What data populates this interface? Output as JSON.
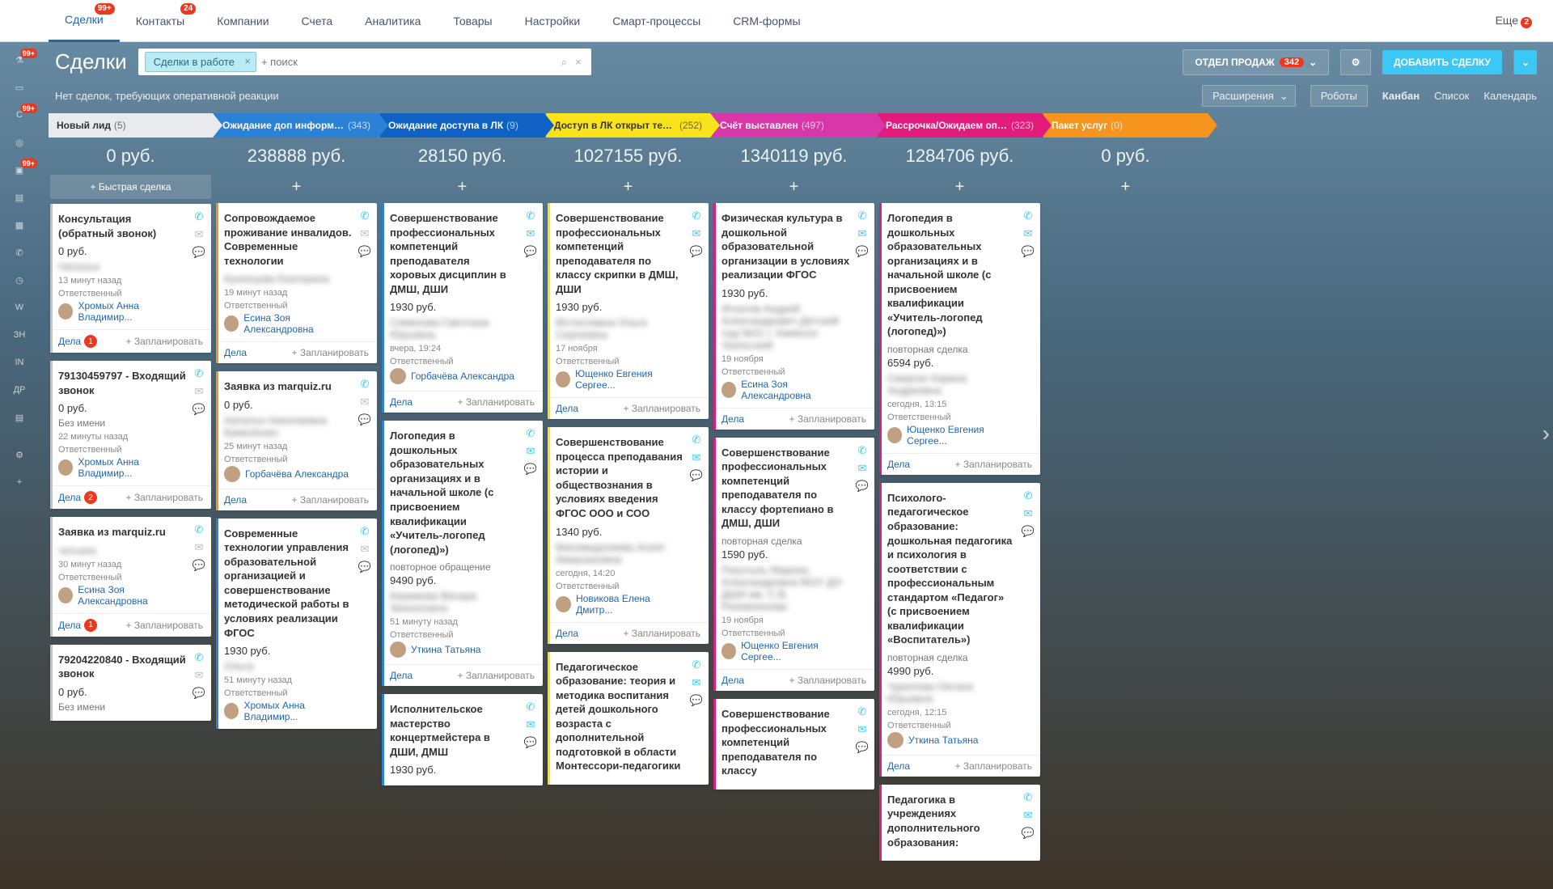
{
  "nav": {
    "items": [
      {
        "label": "Сделки",
        "badge": "99+",
        "active": true
      },
      {
        "label": "Контакты",
        "badge": "24"
      },
      {
        "label": "Компании"
      },
      {
        "label": "Счета"
      },
      {
        "label": "Аналитика"
      },
      {
        "label": "Товары"
      },
      {
        "label": "Настройки"
      },
      {
        "label": "Смарт-процессы"
      },
      {
        "label": "CRM-формы"
      }
    ],
    "more": "Еще",
    "more_badge": "2"
  },
  "page_title": "Сделки",
  "filter_tag": "Сделки в работе",
  "search_placeholder": "+ поиск",
  "dept_btn": {
    "label": "ОТДЕЛ ПРОДАЖ",
    "count": "342"
  },
  "add_btn": "ДОБАВИТЬ СДЕЛКУ",
  "no_reaction": "Нет сделок, требующих оперативной реакции",
  "ext_pill": "Расширения",
  "robots_pill": "Роботы",
  "views": [
    "Канбан",
    "Список",
    "Календарь"
  ],
  "quick_deal": "Быстрая сделка",
  "labels": {
    "responsible": "Ответственный",
    "deals": "Дела",
    "plan": "+ Запланировать",
    "no_name": "Без имени",
    "repeat_deal": "повторная сделка",
    "repeat_req": "повторное обращение"
  },
  "stages": [
    {
      "name": "Новый лид",
      "count": "(5)",
      "sum": "0 руб.",
      "color": "c1"
    },
    {
      "name": "Ожидание доп информации",
      "count": "(343)",
      "sum": "238888 руб.",
      "color": "c2"
    },
    {
      "name": "Ожидание доступа в ЛК",
      "count": "(9)",
      "sum": "28150 руб.",
      "color": "c3"
    },
    {
      "name": "Доступ в ЛК открыт тех отд...",
      "count": "(252)",
      "sum": "1027155 руб.",
      "color": "c4"
    },
    {
      "name": "Счёт выставлен",
      "count": "(497)",
      "sum": "1340119 руб.",
      "color": "c5"
    },
    {
      "name": "Рассрочка/Ожидаем оплаты",
      "count": "(323)",
      "sum": "1284706 руб.",
      "color": "c6"
    },
    {
      "name": "Пакет услуг",
      "count": "(0)",
      "sum": "0 руб.",
      "color": "c7"
    }
  ],
  "cols": [
    [
      {
        "title": "Консультация (обратный звонок)",
        "price": "0 руб.",
        "blur": "Наталья",
        "time": "13 минут назад",
        "assignee": "Хромых Анна Владимир...",
        "bubble": "1",
        "b": "b-grey"
      },
      {
        "title": "79130459797 - Входящий звонок",
        "price": "0 руб.",
        "blur": "",
        "noname": true,
        "time": "22 минуты назад",
        "assignee": "Хромых Анна Владимир...",
        "bubble": "2",
        "b": "b-grey"
      },
      {
        "title": "Заявка из marquiz.ru",
        "price": "",
        "blur": "татьяна",
        "time": "30 минут назад",
        "assignee": "Есина Зоя Александровна",
        "bubble": "1",
        "b": "b-grey"
      },
      {
        "title": "79204220840 - Входящий звонок",
        "price": "0 руб.",
        "noname": true,
        "b": "b-grey",
        "nofooter": true
      }
    ],
    [
      {
        "title": "Сопровождаемое проживание инвалидов. Современные технологии",
        "blur": "Кузнецова Екатерина",
        "time": "19 минут назад",
        "assignee": "Есина Зоя Александровна",
        "b": "b-orange"
      },
      {
        "title": "Заявка из marquiz.ru",
        "price": "0 руб.",
        "blur": "Наталья Николаевна Ермоленко",
        "time": "25 минут назад",
        "assignee": "Горбачёва Александра",
        "b": "b-orange"
      },
      {
        "title": "Современные технологии управления образовательной организацией и совершенствование методической работы в условиях реализации ФГОС",
        "price": "1930 руб.",
        "blur": "Ольга",
        "time": "51 минуту назад",
        "assignee_label": true,
        "assignee": "Хромых Анна Владимир...",
        "b": "b-blue",
        "nofooter": true
      }
    ],
    [
      {
        "title": "Совершенствование профессиональных компетенций преподавателя хоровых дисциплин в ДМШ, ДШИ",
        "price": "1930 руб.",
        "blur": "Семенова Светлана Юрьевна",
        "time": "вчера, 19:24",
        "assignee": "Горбачёва Александра",
        "b": "b-blue"
      },
      {
        "title": "Логопедия в дошкольных образовательных организациях и в начальной школе (с присвоением квалификации «Учитель-логопед (логопед)»)",
        "sub": "повторное обращение",
        "price": "9490 руб.",
        "blur": "Керимова Вачара Зиннатовна",
        "time": "51 минуту назад",
        "assignee": "Уткина Татьяна",
        "b": "b-blue"
      },
      {
        "title": "Исполнительское мастерство концертмейстера в ДШИ, ДМШ",
        "price": "1930 руб.",
        "b": "b-blue",
        "nofooter": true
      }
    ],
    [
      {
        "title": "Совершенствование профессиональных компетенций преподавателя по классу скрипки в ДМШ, ДШИ",
        "price": "1930 руб.",
        "blur": "Мстиславна Ольга Сергеевна",
        "time": "17 ноября",
        "assignee": "Ющенко Евгения Сергее...",
        "b": "b-yellow"
      },
      {
        "title": "Совершенствование процесса преподавания истории и обществознания в условиях введения ФГОС ООО и СОО",
        "price": "1340 руб.",
        "blur": "Магомедалиева Асият Амирхановна",
        "time": "сегодня, 14:20",
        "assignee": "Новикова Елена Дмитр...",
        "b": "b-yellow"
      },
      {
        "title": "Педагогическое образование: теория и методика воспитания детей дошкольного возраста с дополнительной подготовкой в области Монтессори-педагогики",
        "b": "b-yellow",
        "nofooter": true
      }
    ],
    [
      {
        "title": "Физическая культура в дошкольной образовательной организации в условиях реализации ФГОС",
        "price": "1930 руб.",
        "blur": "Игнатов Андрей Александрович Детский сад №51 г. Каменск-Уральский",
        "time": "19 ноября",
        "assignee": "Есина Зоя Александровна",
        "b": "b-pink"
      },
      {
        "title": "Совершенствование профессиональных компетенций преподавателя по классу фортепиано в ДМШ, ДШИ",
        "sub": "повторная сделка",
        "price": "1590 руб.",
        "blur": "Поштыль Марина Александровна МОУ ДО ДШИ им. С.В. Рахманинова",
        "time": "19 ноября",
        "assignee": "Ющенко Евгения Сергее...",
        "b": "b-pink"
      },
      {
        "title": "Совершенствование профессиональных компетенций преподавателя по классу",
        "b": "b-pink",
        "nofooter": true
      }
    ],
    [
      {
        "title": "Логопедия в дошкольных образовательных организациях и в начальной школе (с присвоением квалификации «Учитель-логопед (логопед)»)",
        "sub": "повторная сделка",
        "price": "6594 руб.",
        "blur": "Сморгач Карина Андреевна",
        "time": "сегодня, 13:15",
        "assignee": "Ющенко Евгения Сергее...",
        "b": "b-pink"
      },
      {
        "title": "Психолого-педагогическое образование: дошкольная педагогика и психология в соответствии с профессиональным стандартом «Педагог» (с присвоением квалификации «Воспитатель»)",
        "sub": "повторная сделка",
        "price": "4990 руб.",
        "blur": "Чурилова Оксана Юрьевна",
        "time": "сегодня, 12:15",
        "assignee": "Уткина Татьяна",
        "b": "b-pink"
      },
      {
        "title": "Педагогика в учреждениях дополнительного образования:",
        "b": "b-pink",
        "nofooter": true
      }
    ]
  ],
  "sidebar_badges": [
    "99+",
    "99+",
    "99+"
  ]
}
